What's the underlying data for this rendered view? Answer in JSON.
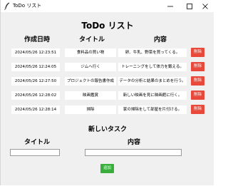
{
  "window": {
    "title": "ToDo リスト"
  },
  "app": {
    "heading": "ToDo リスト"
  },
  "columns": {
    "date": "作成日時",
    "title": "タイトル",
    "content": "内容"
  },
  "tasks": [
    {
      "date": "2024/05/26 12:23:51",
      "title": "食料品の買い物",
      "content": "卵、牛乳、野菜を買ってくる。",
      "delete_label": "削除"
    },
    {
      "date": "2024/05/26 12:24:05",
      "title": "ジムへ行く",
      "content": "トレーニングをして体力を鍛える。",
      "delete_label": "削除"
    },
    {
      "date": "2024/05/26 12:27:50",
      "title": "プロジェクトの報告書作成",
      "content": "データの分析と結果のまとめを行う。",
      "delete_label": "削除"
    },
    {
      "date": "2024/05/26 12:28:02",
      "title": "映画鑑賞",
      "content": "新しい映画を見に映画館に行く。",
      "delete_label": "削除"
    },
    {
      "date": "2024/05/26 12:28:14",
      "title": "掃除",
      "content": "家の掃除をして部屋を片付ける。",
      "delete_label": "削除"
    }
  ],
  "new_task": {
    "heading": "新しいタスク",
    "title_label": "タイトル",
    "content_label": "内容",
    "title_value": "",
    "content_value": "",
    "add_label": "追加"
  },
  "colors": {
    "delete_button": "#e8493b",
    "add_button": "#3aae3d",
    "window_background": "#f0f0f0"
  },
  "icons": {
    "app": "feather-icon",
    "minimize": "minimize-icon",
    "maximize": "maximize-icon",
    "close": "close-icon"
  }
}
